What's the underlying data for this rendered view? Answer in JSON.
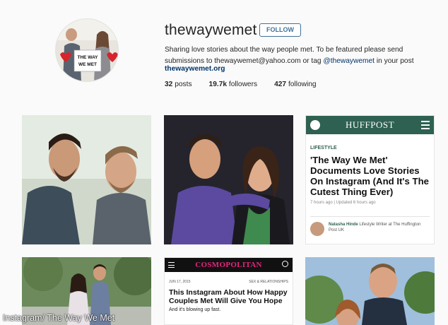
{
  "profile": {
    "username": "thewaywemet",
    "follow_label": "FOLLOW",
    "bio_line1": "Sharing love stories about the way people met. To be featured please send",
    "bio_line2_pre": "submissions to thewaywemet@yahoo.com or tag ",
    "bio_tag": "@thewaywemet",
    "bio_line2_post": " in your post",
    "website": "thewaywemet.org",
    "posts_count": "32",
    "posts_label": "posts",
    "followers_count": "19.7k",
    "followers_label": "followers",
    "following_count": "427",
    "following_label": "following",
    "avatar_sign_text": "THE WAY WE MET"
  },
  "huffpost": {
    "logo": "HUFFPOST",
    "section": "LIFESTYLE",
    "headline": "'The Way We Met' Documents Love Stories On Instagram (And It's The Cutest Thing Ever)",
    "meta": "7 hours ago | Updated 6 hours ago",
    "author_name": "Natasha Hinde",
    "author_desc": " Lifestyle Writer at The Huffington Post UK"
  },
  "cosmo": {
    "logo": "COSMOPOLITAN",
    "date": "JUN 17, 2015",
    "category": "SEX & RELATIONSHIPS",
    "headline": "This Instagram About How Happy Couples Met Will Give You Hope",
    "subhead": "And it's blowing up fast."
  },
  "watermark": "Instagram/ The Way We Met",
  "colors": {
    "follow_blue": "#3f729b",
    "link_blue": "#003569",
    "huffpost_green": "#2e6151",
    "cosmo_pink": "#e6247e"
  },
  "icons": [
    "globe-icon",
    "menu-icon",
    "search-icon",
    "heart-icon"
  ]
}
